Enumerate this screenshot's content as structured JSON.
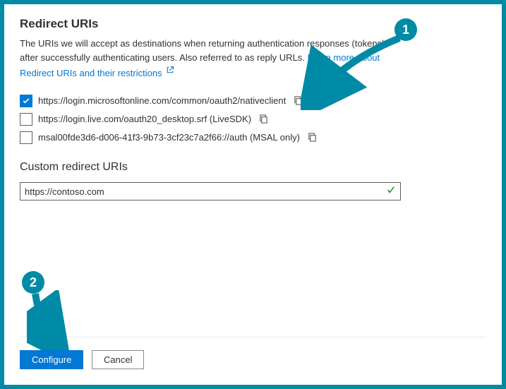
{
  "redirect": {
    "title": "Redirect URIs",
    "desc_before": "The URIs we will accept as destinations when returning authentication responses (tokens) after successfully authenticating users. Also referred to as reply URLs. ",
    "learn_more": "Learn more about Redirect URIs and their restrictions",
    "items": [
      {
        "checked": true,
        "uri": "https://login.microsoftonline.com/common/oauth2/nativeclient"
      },
      {
        "checked": false,
        "uri": "https://login.live.com/oauth20_desktop.srf (LiveSDK)"
      },
      {
        "checked": false,
        "uri": "msal00fde3d6-d006-41f3-9b73-3cf23c7a2f66://auth (MSAL only)"
      }
    ]
  },
  "custom": {
    "title": "Custom redirect URIs",
    "value": "https://contoso.com"
  },
  "footer": {
    "configure": "Configure",
    "cancel": "Cancel"
  },
  "annotations": {
    "callout1": "1",
    "callout2": "2"
  }
}
